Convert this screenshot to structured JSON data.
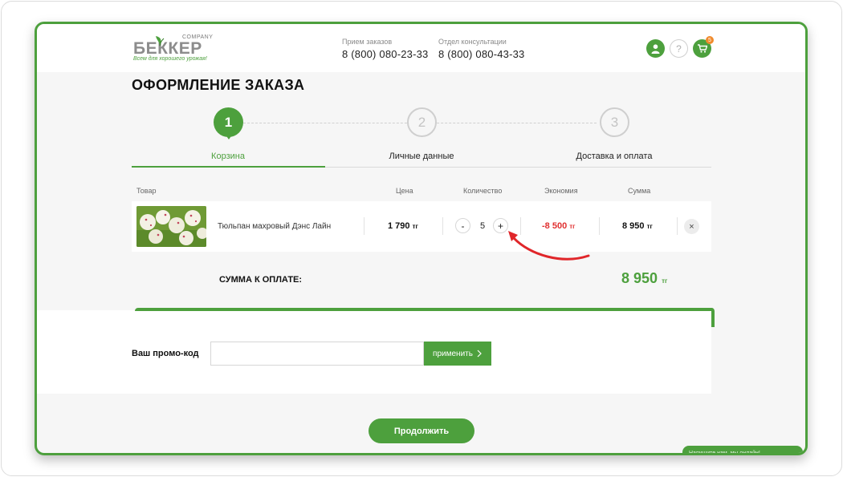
{
  "header": {
    "logo": {
      "company": "COMPANY",
      "brand": "БЕККЕР",
      "tagline": "Всем для хорошего урожая!"
    },
    "contacts": [
      {
        "label": "Прием заказов",
        "phone": "8 (800) 080-23-33"
      },
      {
        "label": "Отдел консультации",
        "phone": "8 (800) 080-43-33"
      }
    ],
    "icons": {
      "account": "user-icon",
      "help": "?",
      "cart": "cart-icon",
      "cart_count": "5"
    }
  },
  "page_title": "ОФОРМЛЕНИЕ ЗАКАЗА",
  "steps": [
    {
      "number": "1",
      "label": "Корзина",
      "active": true
    },
    {
      "number": "2",
      "label": "Личные данные",
      "active": false
    },
    {
      "number": "3",
      "label": "Доставка и оплата",
      "active": false
    }
  ],
  "table": {
    "headers": {
      "product": "Товар",
      "price": "Цена",
      "quantity": "Количество",
      "savings": "Экономия",
      "sum": "Сумма"
    },
    "rows": [
      {
        "name": "Тюльпан махровый Дэнс Лайн",
        "price": "1 790",
        "price_currency": "тг",
        "quantity": "5",
        "minus": "-",
        "plus": "+",
        "savings": "-8 500",
        "savings_currency": "тг",
        "sum": "8 950",
        "sum_currency": "тг",
        "remove": "×"
      }
    ]
  },
  "total": {
    "label": "СУММА К ОПЛАТЕ:",
    "value": "8 950",
    "currency": "тг"
  },
  "promo": {
    "label": "Ваш промо-код",
    "value": "",
    "button": "применить"
  },
  "continue_label": "Продолжить",
  "chat_tab": "Напишите нам, мы онлайн!",
  "colors": {
    "accent": "#4da03d",
    "savings": "#e03030",
    "annotation": "#e0262a"
  }
}
